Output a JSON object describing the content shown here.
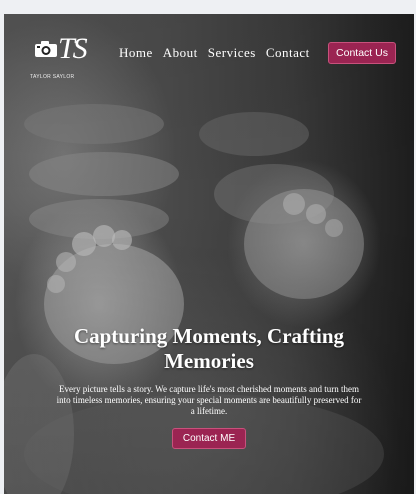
{
  "logo": {
    "monogram": "TS",
    "brand_text": "TAYLOR SAYLOR",
    "icon": "camera-icon"
  },
  "nav": {
    "items": [
      {
        "label": "Home"
      },
      {
        "label": "About"
      },
      {
        "label": "Services"
      },
      {
        "label": "Contact"
      }
    ]
  },
  "header": {
    "cta_label": "Contact Us"
  },
  "hero": {
    "headline": "Capturing Moments, Crafting Memories",
    "description": "Every picture tells a story. We capture life's most cherished moments and turn them into timeless memories, ensuring your special moments are beautifully preserved for a lifetime.",
    "cta_label": "Contact ME",
    "image": "baby-feet-in-hands-photo"
  },
  "colors": {
    "accent": "#9b2452",
    "accent_border": "#c8517c",
    "page_bg": "#eef0f3"
  }
}
